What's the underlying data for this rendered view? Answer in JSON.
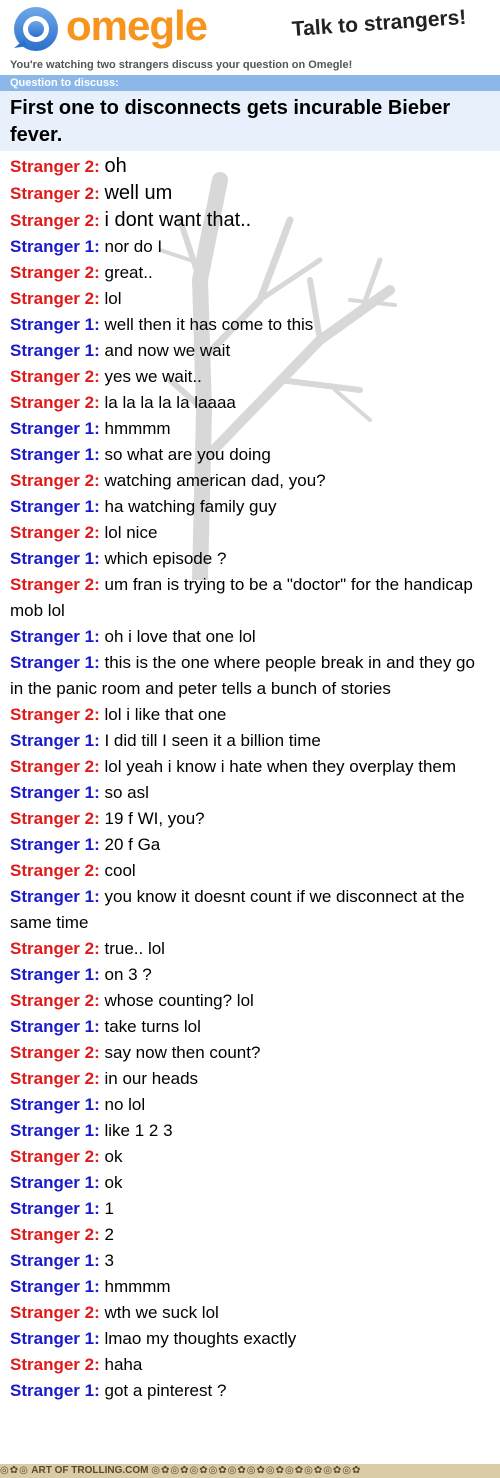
{
  "header": {
    "logo_text": "omegle",
    "tagline": "Talk to strangers!"
  },
  "subtitle": "You're watching two strangers discuss your question on Omegle!",
  "question": {
    "label": "Question to discuss:",
    "text": "First one to disconnects gets incurable Bieber fever."
  },
  "colors": {
    "stranger1": "#1a1acc",
    "stranger2": "#e01a1a",
    "logo": "#f7941d"
  },
  "messages": [
    {
      "who": "Stranger 2:",
      "text": "oh"
    },
    {
      "who": "Stranger 2:",
      "text": "well um"
    },
    {
      "who": "Stranger 2:",
      "text": "i dont want that.."
    },
    {
      "who": "Stranger 1:",
      "text": "nor do I"
    },
    {
      "who": "Stranger 2:",
      "text": "great.."
    },
    {
      "who": "Stranger 2:",
      "text": "lol"
    },
    {
      "who": "Stranger 1:",
      "text": "well then it has come to this"
    },
    {
      "who": "Stranger 1:",
      "text": "and now we wait"
    },
    {
      "who": "Stranger 2:",
      "text": "yes we wait.."
    },
    {
      "who": "Stranger 2:",
      "text": "la la la la la laaaa"
    },
    {
      "who": "Stranger 1:",
      "text": "hmmmm"
    },
    {
      "who": "Stranger 1:",
      "text": "so what are you doing"
    },
    {
      "who": "Stranger 2:",
      "text": "watching american dad, you?"
    },
    {
      "who": "Stranger 1:",
      "text": "ha watching family guy"
    },
    {
      "who": "Stranger 2:",
      "text": "lol nice"
    },
    {
      "who": "Stranger 1:",
      "text": "which episode ?"
    },
    {
      "who": "Stranger 2:",
      "text": "um fran is trying to be a \"doctor\" for the handicap mob lol"
    },
    {
      "who": "Stranger 1:",
      "text": "oh i love that one lol"
    },
    {
      "who": "Stranger 1:",
      "text": "this is the one where people break in and they go in the panic room and peter tells a bunch of stories"
    },
    {
      "who": "Stranger 2:",
      "text": "lol i like that one"
    },
    {
      "who": "Stranger 1:",
      "text": "I did till I seen it a billion time"
    },
    {
      "who": "Stranger 2:",
      "text": "lol yeah i know i hate when they overplay them"
    },
    {
      "who": "Stranger 1:",
      "text": "so asl"
    },
    {
      "who": "Stranger 2:",
      "text": "19 f WI, you?"
    },
    {
      "who": "Stranger 1:",
      "text": "20 f Ga"
    },
    {
      "who": "Stranger 2:",
      "text": "cool"
    },
    {
      "who": "Stranger 1:",
      "text": "you know it doesnt count if we disconnect at the same time"
    },
    {
      "who": "Stranger 2:",
      "text": "true.. lol"
    },
    {
      "who": "Stranger 1:",
      "text": "on 3 ?"
    },
    {
      "who": "Stranger 2:",
      "text": "whose counting? lol"
    },
    {
      "who": "Stranger 1:",
      "text": "take turns lol"
    },
    {
      "who": "Stranger 2:",
      "text": "say now then count?"
    },
    {
      "who": "Stranger 2:",
      "text": "in our heads"
    },
    {
      "who": "Stranger 1:",
      "text": "no lol"
    },
    {
      "who": "Stranger 1:",
      "text": "like 1 2 3"
    },
    {
      "who": "Stranger 2:",
      "text": "ok"
    },
    {
      "who": "Stranger 1:",
      "text": "ok"
    },
    {
      "who": "Stranger 1:",
      "text": "1"
    },
    {
      "who": "Stranger 2:",
      "text": "2"
    },
    {
      "who": "Stranger 1:",
      "text": "3"
    },
    {
      "who": "Stranger 1:",
      "text": "hmmmm"
    },
    {
      "who": "Stranger 2:",
      "text": "wth we suck lol"
    },
    {
      "who": "Stranger 1:",
      "text": "lmao my thoughts exactly"
    },
    {
      "who": "Stranger 2:",
      "text": "haha"
    },
    {
      "who": "Stranger 1:",
      "text": "got a pinterest ?"
    }
  ],
  "footer": {
    "watermark": "ART OF TROLLING.COM"
  }
}
